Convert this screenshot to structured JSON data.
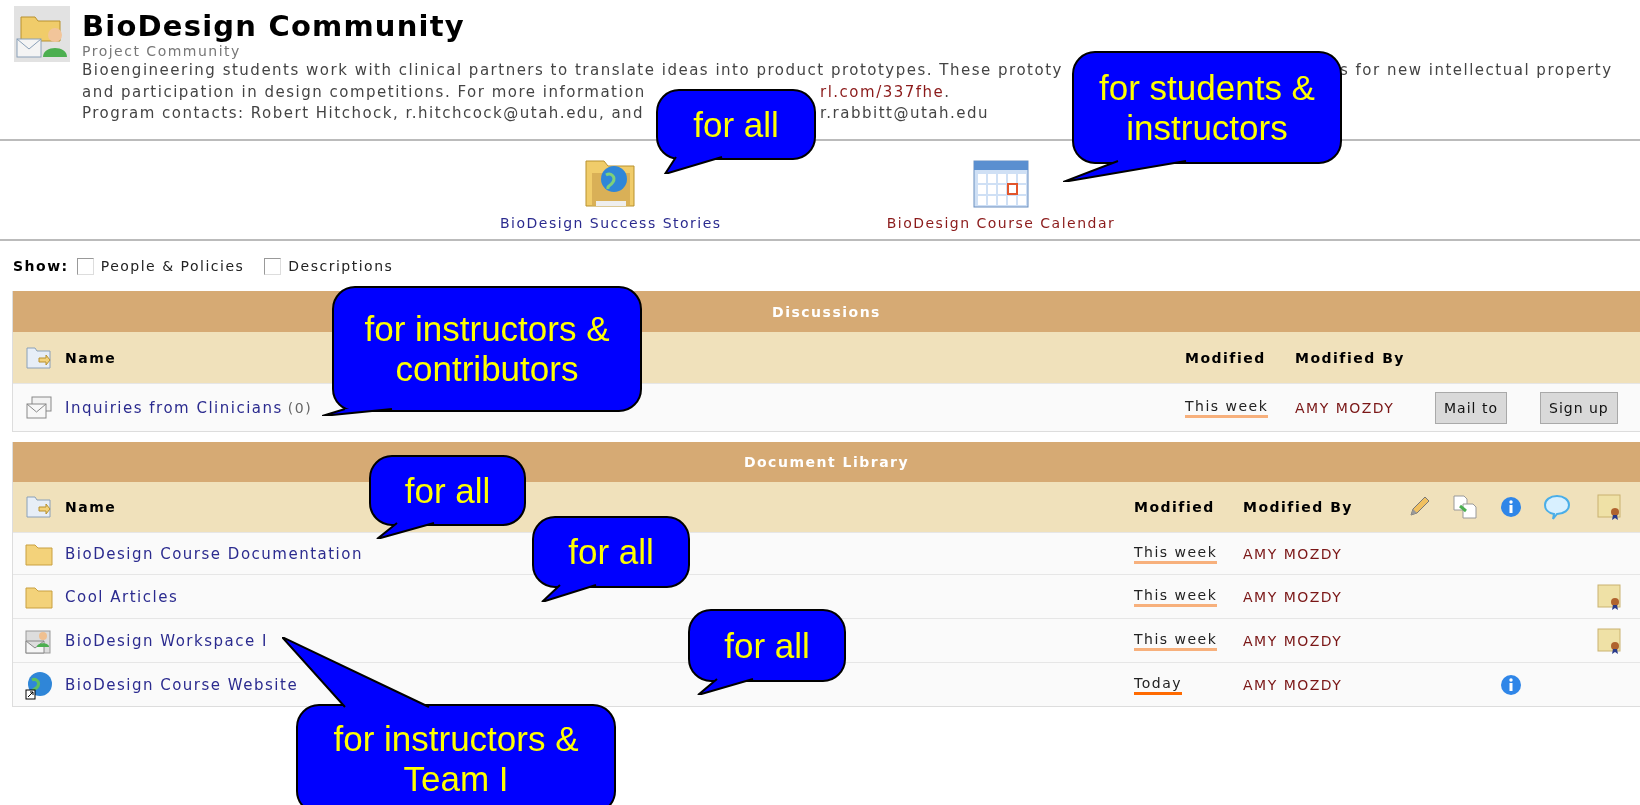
{
  "header": {
    "title": "BioDesign Community",
    "subtitle": "Project Community",
    "description_lines": [
      {
        "fragments": [
          {
            "text": "Bioengineering students work with clinical partners to translate ideas into product prototypes. These prototy",
            "kind": "text"
          },
          {
            "text": "s for new intellectual property",
            "kind": "text"
          }
        ]
      },
      {
        "fragments": [
          {
            "text": "and participation in design competitions. For more information",
            "kind": "text"
          },
          {
            "text": "rl.com/337fhe",
            "kind": "link"
          },
          {
            "text": ".",
            "kind": "text"
          }
        ]
      },
      {
        "fragments": [
          {
            "text": "Program contacts: Robert Hitchock, r.hitchcock@utah.edu, and",
            "kind": "text"
          },
          {
            "text": "r.rabbitt@utah.edu",
            "kind": "text"
          }
        ]
      }
    ]
  },
  "links": [
    {
      "label": "BioDesign Success Stories",
      "kind": "globe",
      "visited": false
    },
    {
      "label": "BioDesign Course Calendar",
      "kind": "calendar",
      "visited": true
    }
  ],
  "show": {
    "label": "Show:",
    "options": [
      {
        "label": "People & Policies",
        "checked": false
      },
      {
        "label": "Descriptions",
        "checked": false
      }
    ]
  },
  "discussions": {
    "title": "Discussions",
    "columns": [
      "Name",
      "Modified",
      "Modified By"
    ],
    "rows": [
      {
        "kind": "discussion",
        "name": "Inquiries from Clinicians",
        "count": "(0)",
        "modified": "This week",
        "color": "#f7b07c",
        "modified_by": "AMY MOZDY",
        "buttons": [
          "Mail to",
          "Sign up"
        ]
      }
    ]
  },
  "document_library": {
    "title": "Document Library",
    "columns": [
      "Name",
      "Modified",
      "Modified By"
    ],
    "rows": [
      {
        "kind": "folder",
        "name": "BioDesign Course Documentation",
        "modified": "This week",
        "color": "#f7b07c",
        "modified_by": "AMY MOZDY",
        "info": false,
        "award": false
      },
      {
        "kind": "folder",
        "name": "Cool Articles",
        "modified": "This week",
        "color": "#f7b07c",
        "modified_by": "AMY MOZDY",
        "info": false,
        "award": true
      },
      {
        "kind": "workspace",
        "name": "BioDesign Workspace I",
        "modified": "This week",
        "color": "#f7b07c",
        "modified_by": "AMY MOZDY",
        "info": false,
        "award": true
      },
      {
        "kind": "website",
        "name": "BioDesign Course Website",
        "modified": "Today",
        "color": "#ff6a00",
        "modified_by": "AMY MOZDY",
        "info": true,
        "award": false
      }
    ]
  },
  "callouts": [
    {
      "text": "for all"
    },
    {
      "text": "for students & instructors"
    },
    {
      "text": "for instructors & contributors"
    },
    {
      "text": "for all"
    },
    {
      "text": "for all"
    },
    {
      "text": "for all"
    },
    {
      "text": "for instructors & Team I"
    }
  ]
}
